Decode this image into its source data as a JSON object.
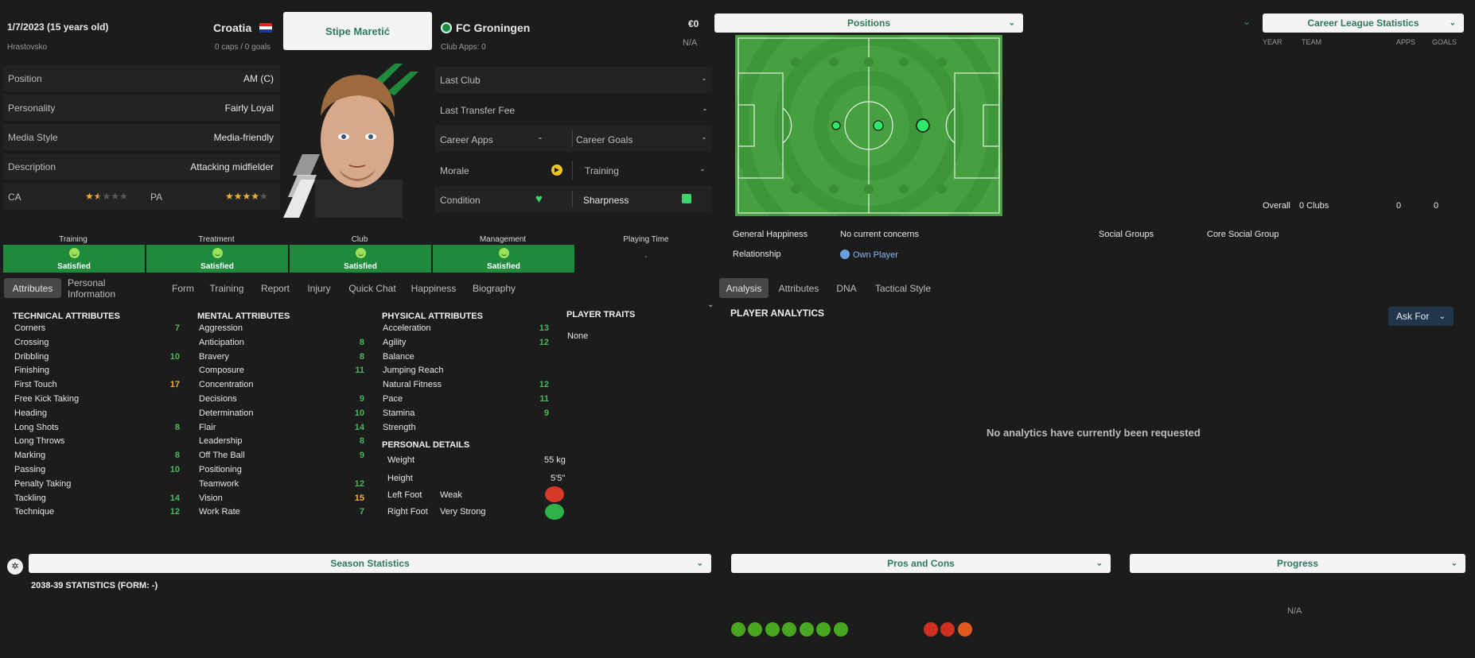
{
  "player": {
    "dob": "1/7/2023 (15 years old)",
    "birthplace": "Hrastovsko",
    "nation": "Croatia",
    "caps": "0 caps / 0 goals",
    "name": "Stipe Maretić",
    "club": "FC Groningen",
    "club_apps": "Club Apps: 0",
    "value": "€0",
    "wage": "N/A"
  },
  "info_rows": [
    {
      "label": "Position",
      "value": "AM (C)"
    },
    {
      "label": "Personality",
      "value": "Fairly Loyal"
    },
    {
      "label": "Media Style",
      "value": "Media-friendly"
    },
    {
      "label": "Description",
      "value": "Attacking midfielder"
    }
  ],
  "ability": {
    "ca_label": "CA",
    "ca_stars": 1.5,
    "pa_label": "PA",
    "pa_stars": 4
  },
  "club_rows": {
    "last_club_label": "Last Club",
    "last_club_value": "-",
    "transfer_label": "Last Transfer Fee",
    "transfer_value": "-",
    "career_apps_label": "Career Apps",
    "career_apps_value": "-",
    "career_goals_label": "Career Goals",
    "career_goals_value": "-",
    "morale_label": "Morale",
    "training_label": "Training",
    "training_value": "-",
    "condition_label": "Condition",
    "sharpness_label": "Sharpness"
  },
  "happiness": {
    "items": [
      {
        "head": "Training",
        "status": "Satisfied"
      },
      {
        "head": "Treatment",
        "status": "Satisfied"
      },
      {
        "head": "Club",
        "status": "Satisfied"
      },
      {
        "head": "Management",
        "status": "Satisfied"
      }
    ],
    "playing_time_head": "Playing Time",
    "playing_time_value": "-"
  },
  "tabs": [
    "Attributes",
    "Personal Information",
    "Form",
    "Training",
    "Report",
    "Injury",
    "Quick Chat",
    "Happiness",
    "Biography"
  ],
  "attributes": {
    "technical_title": "TECHNICAL ATTRIBUTES",
    "technical": [
      {
        "name": "Corners",
        "value": "7"
      },
      {
        "name": "Crossing",
        "value": ""
      },
      {
        "name": "Dribbling",
        "value": "10"
      },
      {
        "name": "Finishing",
        "value": ""
      },
      {
        "name": "First Touch",
        "value": "17"
      },
      {
        "name": "Free Kick Taking",
        "value": ""
      },
      {
        "name": "Heading",
        "value": ""
      },
      {
        "name": "Long Shots",
        "value": "8"
      },
      {
        "name": "Long Throws",
        "value": ""
      },
      {
        "name": "Marking",
        "value": "8"
      },
      {
        "name": "Passing",
        "value": "10"
      },
      {
        "name": "Penalty Taking",
        "value": ""
      },
      {
        "name": "Tackling",
        "value": "14"
      },
      {
        "name": "Technique",
        "value": "12"
      }
    ],
    "mental_title": "MENTAL ATTRIBUTES",
    "mental": [
      {
        "name": "Aggression",
        "value": ""
      },
      {
        "name": "Anticipation",
        "value": "8"
      },
      {
        "name": "Bravery",
        "value": "8"
      },
      {
        "name": "Composure",
        "value": "11"
      },
      {
        "name": "Concentration",
        "value": ""
      },
      {
        "name": "Decisions",
        "value": "9"
      },
      {
        "name": "Determination",
        "value": "10"
      },
      {
        "name": "Flair",
        "value": "14"
      },
      {
        "name": "Leadership",
        "value": "8"
      },
      {
        "name": "Off The Ball",
        "value": "9"
      },
      {
        "name": "Positioning",
        "value": ""
      },
      {
        "name": "Teamwork",
        "value": "12"
      },
      {
        "name": "Vision",
        "value": "15"
      },
      {
        "name": "Work Rate",
        "value": "7"
      }
    ],
    "physical_title": "PHYSICAL ATTRIBUTES",
    "physical": [
      {
        "name": "Acceleration",
        "value": "13"
      },
      {
        "name": "Agility",
        "value": "12"
      },
      {
        "name": "Balance",
        "value": ""
      },
      {
        "name": "Jumping Reach",
        "value": ""
      },
      {
        "name": "Natural Fitness",
        "value": "12"
      },
      {
        "name": "Pace",
        "value": "11"
      },
      {
        "name": "Stamina",
        "value": "9"
      },
      {
        "name": "Strength",
        "value": ""
      }
    ],
    "traits_title": "PLAYER TRAITS",
    "traits_value": "None"
  },
  "personal": {
    "title": "PERSONAL DETAILS",
    "weight_label": "Weight",
    "weight": "55 kg",
    "height_label": "Height",
    "height": "5'5\"",
    "left_label": "Left Foot",
    "left": "Weak",
    "right_label": "Right Foot",
    "right": "Very Strong"
  },
  "positions_panel": {
    "dropdown": "Positions"
  },
  "career": {
    "dropdown": "Career League Statistics",
    "cols": [
      "YEAR",
      "TEAM",
      "APPS",
      "GOALS"
    ],
    "overall_label": "Overall",
    "overall_team": "0 Clubs",
    "overall_apps": "0",
    "overall_goals": "0"
  },
  "social": {
    "happiness_label": "General Happiness",
    "happiness_value": "No current concerns",
    "relationship_label": "Relationship",
    "relationship_value": "Own Player",
    "groups_label": "Social Groups",
    "groups_value": "Core Social Group"
  },
  "right_tabs": [
    "Analysis",
    "Attributes",
    "DNA",
    "Tactical Style"
  ],
  "analytics": {
    "title": "PLAYER ANALYTICS",
    "ask_button": "Ask For",
    "empty": "No analytics have currently been requested"
  },
  "bottom": {
    "season_dropdown": "Season Statistics",
    "season_text": "2038-39 STATISTICS (FORM: -)",
    "pros_dropdown": "Pros and Cons",
    "progress_dropdown": "Progress",
    "progress_value": "N/A"
  },
  "colors": {
    "accent": "#2f7a5a",
    "green": "#4fb55f",
    "yellow": "#f0b43a",
    "satisfied": "#1f8a3c"
  }
}
